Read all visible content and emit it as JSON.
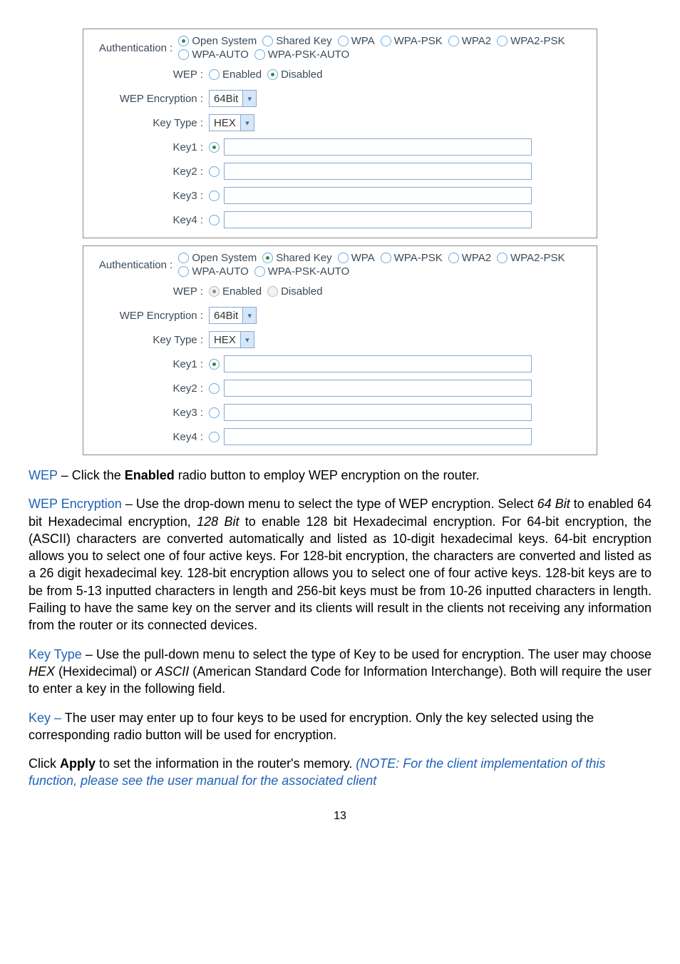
{
  "panel1": {
    "auth_label": "Authentication :",
    "auth_opts": [
      "Open System",
      "Shared Key",
      "WPA",
      "WPA-PSK",
      "WPA2",
      "WPA2-PSK",
      "WPA-AUTO",
      "WPA-PSK-AUTO"
    ],
    "wep_label": "WEP :",
    "wep_opts": [
      "Enabled",
      "Disabled"
    ],
    "wep_enc_label": "WEP Encryption :",
    "wep_enc_value": "64Bit",
    "key_type_label": "Key Type :",
    "key_type_value": "HEX",
    "key1_label": "Key1 :",
    "key2_label": "Key2 :",
    "key3_label": "Key3 :",
    "key4_label": "Key4 :"
  },
  "panel2": {
    "auth_label": "Authentication :",
    "auth_opts": [
      "Open System",
      "Shared Key",
      "WPA",
      "WPA-PSK",
      "WPA2",
      "WPA2-PSK",
      "WPA-AUTO",
      "WPA-PSK-AUTO"
    ],
    "wep_label": "WEP :",
    "wep_opts": [
      "Enabled",
      "Disabled"
    ],
    "wep_enc_label": "WEP Encryption :",
    "wep_enc_value": "64Bit",
    "key_type_label": "Key Type :",
    "key_type_value": "HEX",
    "key1_label": "Key1 :",
    "key2_label": "Key2 :",
    "key3_label": "Key3 :",
    "key4_label": "Key4 :"
  },
  "para": {
    "wep_term": "WEP",
    "wep_text_a": " – Click the ",
    "wep_text_bold": "Enabled",
    "wep_text_b": " radio button to employ WEP encryption on the router.",
    "wepenc_term": "WEP Encryption",
    "wepenc_text_a": " – Use the drop-down menu to select the type of WEP encryption. Select ",
    "wepenc_i1": "64 Bit",
    "wepenc_text_b": " to enabled 64 bit Hexadecimal encryption, ",
    "wepenc_i2": "128 Bit",
    "wepenc_text_c": " to enable 128 bit Hexadecimal encryption. For 64-bit encryption, the (ASCII) characters are converted automatically and listed as 10-digit hexadecimal keys. 64-bit encryption allows you to select one of four active keys. For 128-bit encryption, the characters are converted and listed as a 26 digit hexadecimal key. 128-bit encryption allows you to select one of four active keys. 128-bit keys are to be from 5-13 inputted characters in length and 256-bit keys must be from 10-26 inputted characters in length. Failing to have the same key on the server and its clients will result in the clients not receiving any information from the router or its connected devices.",
    "ktype_term": "Key Type",
    "ktype_text_a": " – Use the pull-down menu to select the type of Key to be used for encryption. The user may choose ",
    "ktype_i1": "HEX",
    "ktype_text_b": " (Hexidecimal) or ",
    "ktype_i2": "ASCII",
    "ktype_text_c": " (American Standard Code for Information Interchange). Both will require the user to enter a key in the following field.",
    "key_term": "Key – ",
    "key_text": "The user may enter up to four keys to be used for encryption. Only the key selected using the corresponding radio button will be used for encryption.",
    "apply_a": "Click ",
    "apply_bold": "Apply",
    "apply_b": " to set the information in the router's memory. ",
    "apply_note": "(NOTE: For the client implementation of this function, please see the user manual for the associated client"
  },
  "pagenum": "13"
}
